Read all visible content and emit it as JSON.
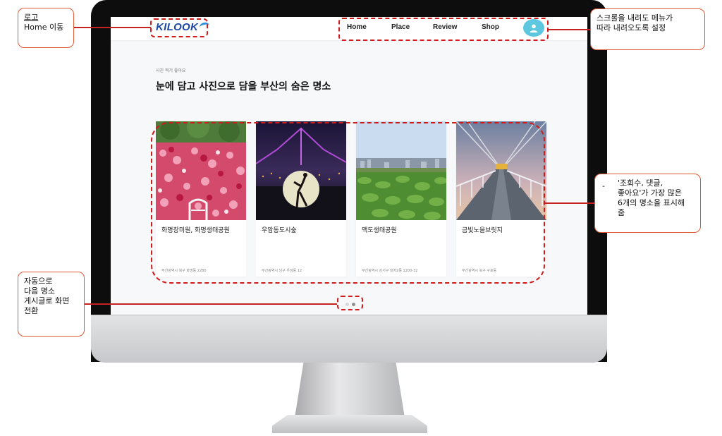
{
  "app": {
    "logo_text": "KILOOK",
    "nav": [
      "Home",
      "Place",
      "Review",
      "Shop"
    ]
  },
  "section": {
    "subtitle": "사진 찍기 좋아요",
    "title": "눈에 담고 사진으로 담을 부산의 숨은 명소"
  },
  "cards": [
    {
      "name": "화명장미원, 화명생태공원",
      "address": "부산광역시 북구 화명동 2280"
    },
    {
      "name": "우암동도시숲",
      "address": "부산광역시 남구 우암동 12"
    },
    {
      "name": "맥도생태공원",
      "address": "부산광역시 강서구 대저2동 1200-32"
    },
    {
      "name": "금빛노을브릿지",
      "address": "부산광역시 북구 구포동"
    }
  ],
  "annotations": {
    "logo_line1": "로고",
    "logo_line2": "Home 이동",
    "menu_line1": "스크롤을 내려도 메뉴가",
    "menu_line2": "따라 내려오도록 설정",
    "cards_bullet": "-",
    "cards_line1": "'조회수, 댓글,",
    "cards_line2": "좋아요'가 가장 많은",
    "cards_line3": "6개의 명소을 표시해",
    "cards_line4": "줌",
    "auto_line1": "자동으로",
    "auto_line2": "다음 명소",
    "auto_line3": "게시글로 화면",
    "auto_line4": "전환"
  },
  "colors": {
    "accent_blue": "#1b47a6",
    "user_button": "#5cc7de",
    "annotation_border": "#e05a34",
    "dashed_highlight": "#d11a1a"
  },
  "icons": [
    "user-icon"
  ]
}
